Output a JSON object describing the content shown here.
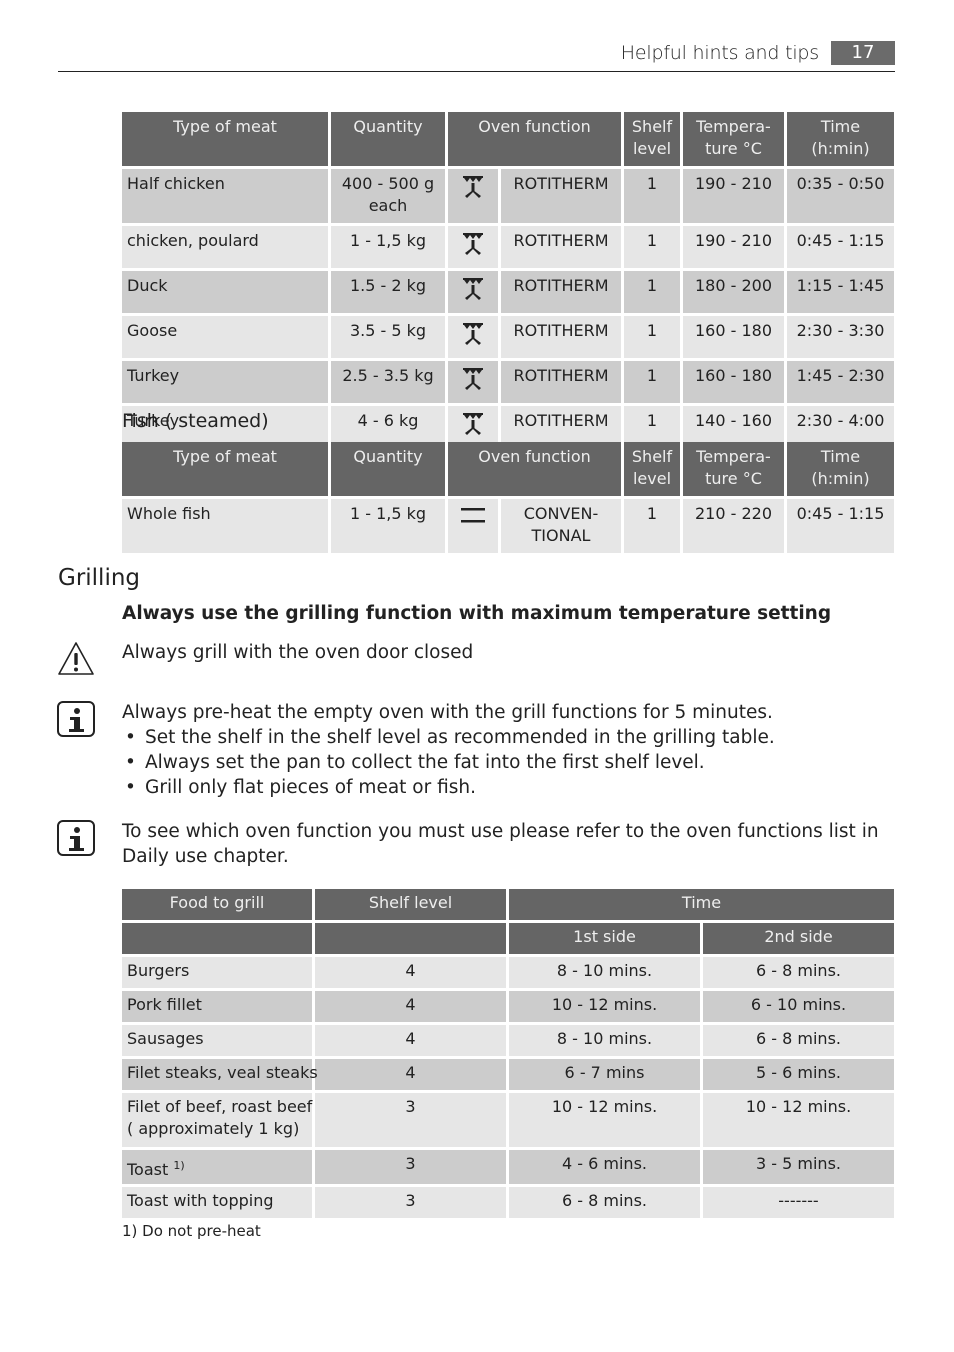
{
  "header": {
    "section_title": "Helpful hints and tips",
    "page_number": "17"
  },
  "meat_table": {
    "headers": [
      "Type of meat",
      "Quantity",
      "Oven function",
      "Shelf level",
      "Tempera-ture °C",
      "Time (h:min)"
    ],
    "header_lines": {
      "type": "Type of meat",
      "quantity": "Quantity",
      "function": "Oven function",
      "shelf_1": "Shelf",
      "shelf_2": "level",
      "temp_1": "Tempera-",
      "temp_2": "ture °C",
      "time_1": "Time",
      "time_2": "(h:min)"
    },
    "rows": [
      {
        "type": "Half chicken",
        "quantity_1": "400 - 500 g",
        "quantity_2": "each",
        "icon": "rotitherm-icon",
        "function": "ROTITHERM",
        "shelf": "1",
        "temp": "190 - 210",
        "time": "0:35 - 0:50"
      },
      {
        "type": "chicken, poulard",
        "quantity_1": "1 - 1,5 kg",
        "quantity_2": "",
        "icon": "rotitherm-icon",
        "function": "ROTITHERM",
        "shelf": "1",
        "temp": "190 - 210",
        "time": "0:45 - 1:15"
      },
      {
        "type": "Duck",
        "quantity_1": "1.5 - 2 kg",
        "quantity_2": "",
        "icon": "rotitherm-icon",
        "function": "ROTITHERM",
        "shelf": "1",
        "temp": "180 - 200",
        "time": "1:15 - 1:45"
      },
      {
        "type": "Goose",
        "quantity_1": "3.5 - 5 kg",
        "quantity_2": "",
        "icon": "rotitherm-icon",
        "function": "ROTITHERM",
        "shelf": "1",
        "temp": "160 - 180",
        "time": "2:30 - 3:30"
      },
      {
        "type": "Turkey",
        "quantity_1": "2.5 - 3.5 kg",
        "quantity_2": "",
        "icon": "rotitherm-icon",
        "function": "ROTITHERM",
        "shelf": "1",
        "temp": "160 - 180",
        "time": "1:45 - 2:30"
      },
      {
        "type": "Turkey",
        "quantity_1": "4 - 6 kg",
        "quantity_2": "",
        "icon": "rotitherm-icon",
        "function": "ROTITHERM",
        "shelf": "1",
        "temp": "140 - 160",
        "time": "2:30 - 4:00"
      }
    ]
  },
  "fish_section": {
    "title": "Fish ( steamed)",
    "row": {
      "type": "Whole fish",
      "quantity": "1 - 1,5 kg",
      "icon": "conventional-icon",
      "function_1": "CONVEN-",
      "function_2": "TIONAL",
      "shelf": "1",
      "temp": "210 - 220",
      "time": "0:45 - 1:15"
    }
  },
  "grilling": {
    "title": "Grilling",
    "bold_note": "Always use the grilling function with maximum temperature setting",
    "warning": {
      "icon": "warning-icon",
      "text": "Always grill with the oven door closed"
    },
    "info1": {
      "icon": "info-icon",
      "text": "Always pre-heat the empty oven with the grill functions for 5 minutes.",
      "bullets": [
        "Set the shelf in the shelf level as recommended in the grilling table.",
        "Always set the pan to collect the fat into the first shelf level.",
        "Grill only flat pieces of meat or fish."
      ]
    },
    "info2": {
      "icon": "info-icon",
      "text": "To see which oven function you must use please refer to the oven functions list in Daily use chapter."
    }
  },
  "grill_table": {
    "headers": {
      "food": "Food to grill",
      "shelf": "Shelf level",
      "time": "Time",
      "side1": "1st side",
      "side2": "2nd side"
    },
    "rows": [
      {
        "food_1": "Burgers",
        "food_2": "",
        "sup": "",
        "shelf": "4",
        "side1": "8 - 10 mins.",
        "side2": "6 - 8 mins."
      },
      {
        "food_1": "Pork fillet",
        "food_2": "",
        "sup": "",
        "shelf": "4",
        "side1": "10 - 12 mins.",
        "side2": "6 - 10 mins."
      },
      {
        "food_1": "Sausages",
        "food_2": "",
        "sup": "",
        "shelf": "4",
        "side1": "8 - 10 mins.",
        "side2": "6 - 8 mins."
      },
      {
        "food_1": "Filet steaks, veal steaks",
        "food_2": "",
        "sup": "",
        "shelf": "4",
        "side1": "6 - 7 mins",
        "side2": "5 - 6 mins."
      },
      {
        "food_1": "Filet of beef, roast beef",
        "food_2": "( approximately 1 kg)",
        "sup": "",
        "shelf": "3",
        "side1": "10 - 12 mins.",
        "side2": "10 - 12 mins."
      },
      {
        "food_1": "Toast",
        "food_2": "",
        "sup": "1)",
        "shelf": "3",
        "side1": "4 - 6 mins.",
        "side2": "3 - 5 mins."
      },
      {
        "food_1": "Toast with topping",
        "food_2": "",
        "sup": "",
        "shelf": "3",
        "side1": "6 - 8 mins.",
        "side2": "-------"
      }
    ],
    "footnote": "1) Do not pre-heat"
  },
  "colors": {
    "header_bg": "#656565",
    "row_light": "#e6e6e6",
    "row_dark": "#cccccc",
    "page_badge": "#6b6b6b"
  }
}
